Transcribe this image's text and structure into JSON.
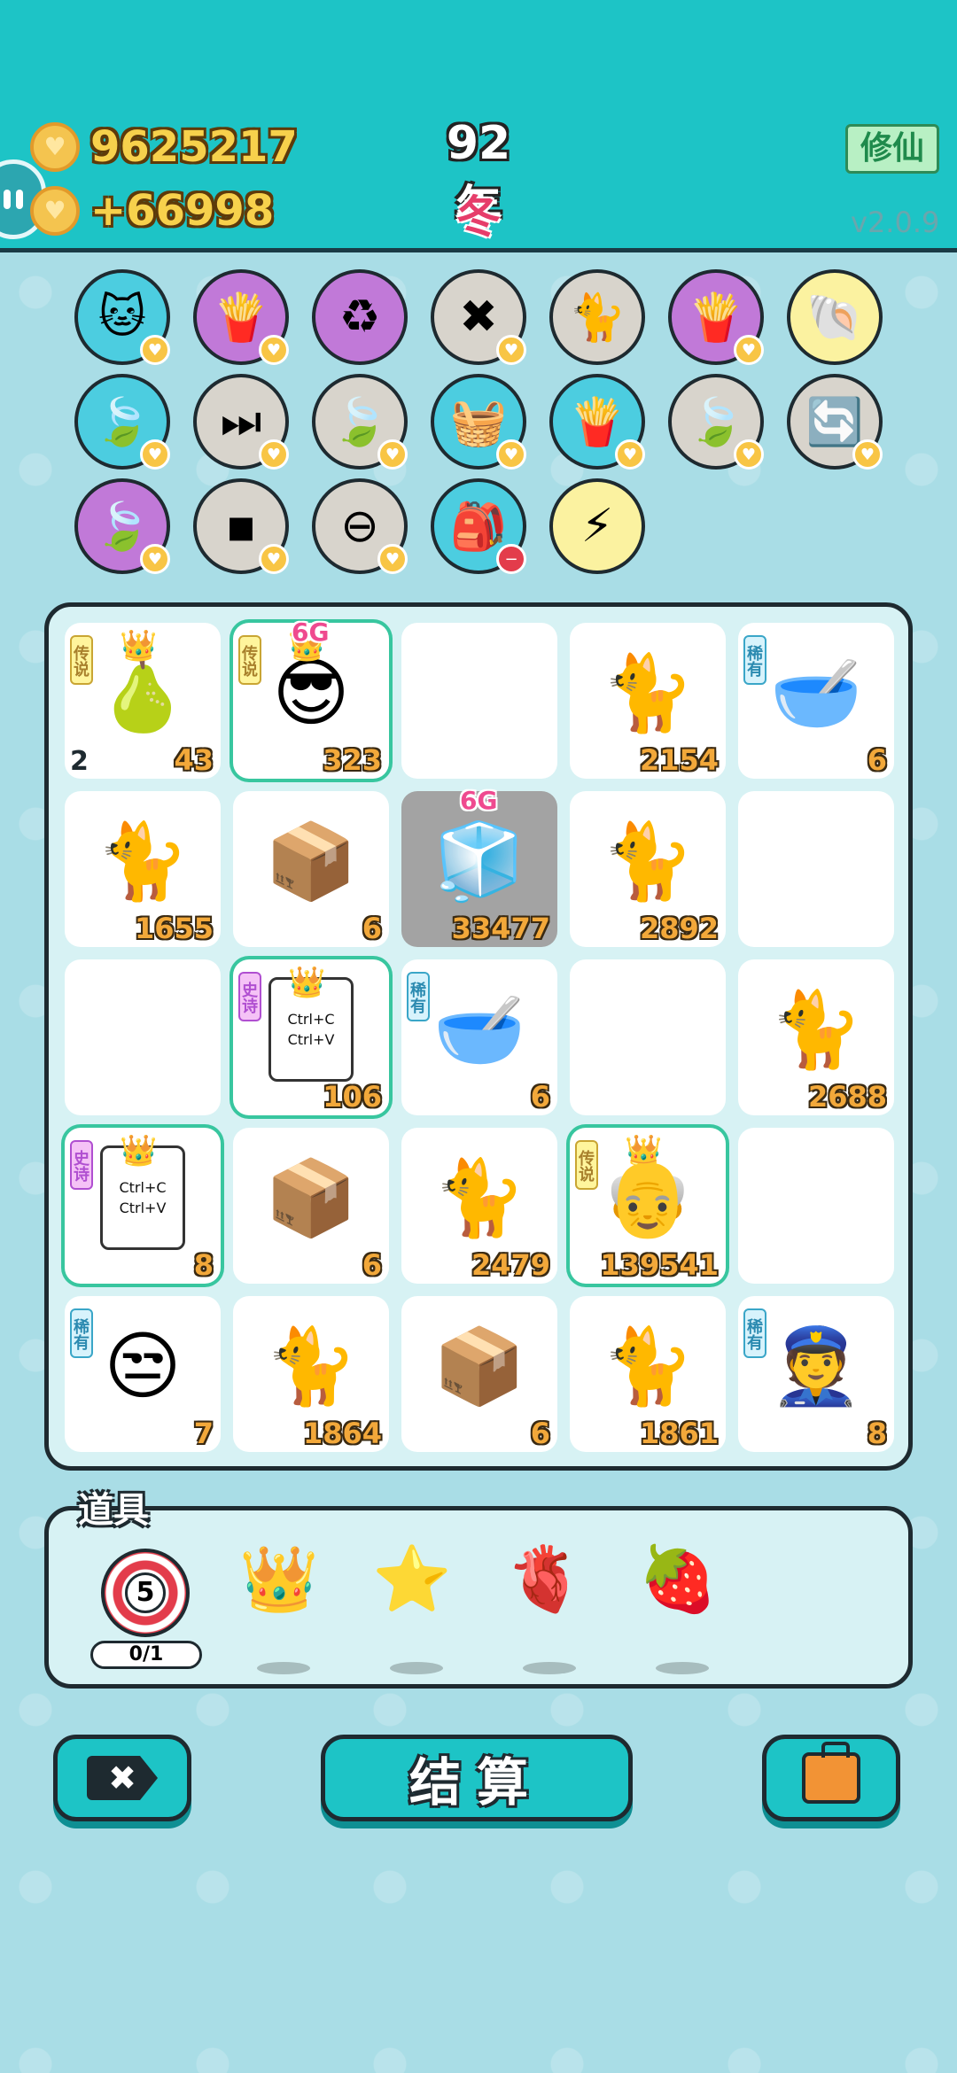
{
  "header": {
    "gold": "9625217",
    "income": "+66998",
    "year": "92年",
    "season": "冬",
    "mode_label": "修仙",
    "version": "v2.0.9"
  },
  "skills": [
    {
      "name": "cat-heads",
      "glyph": "🐱",
      "color": "cyan",
      "badge": "heart"
    },
    {
      "name": "fries",
      "glyph": "🍟",
      "color": "purple",
      "badge": "heart"
    },
    {
      "name": "recycle",
      "glyph": "♻",
      "color": "purple",
      "badge": ""
    },
    {
      "name": "delete-tag",
      "glyph": "✖",
      "color": "grey",
      "badge": "heart"
    },
    {
      "name": "twin-cats",
      "glyph": "🐈",
      "color": "grey",
      "badge": ""
    },
    {
      "name": "fries-2",
      "glyph": "🍟",
      "color": "purple",
      "badge": "heart"
    },
    {
      "name": "shell",
      "glyph": "🐚",
      "color": "yellow",
      "badge": ""
    },
    {
      "name": "leaf",
      "glyph": "🍃",
      "color": "cyan",
      "badge": "heart"
    },
    {
      "name": "skip",
      "glyph": "⏭",
      "color": "grey",
      "badge": "heart"
    },
    {
      "name": "leaf-2",
      "glyph": "🍃",
      "color": "grey",
      "badge": "heart"
    },
    {
      "name": "fruit-basket",
      "glyph": "🧺",
      "color": "cyan",
      "badge": "heart"
    },
    {
      "name": "fries-3",
      "glyph": "🍟",
      "color": "cyan",
      "badge": "heart"
    },
    {
      "name": "leaf-3",
      "glyph": "🍃",
      "color": "grey",
      "badge": "heart"
    },
    {
      "name": "refresh",
      "glyph": "🔄",
      "color": "grey",
      "badge": "heart"
    },
    {
      "name": "leaf-4",
      "glyph": "🍃",
      "color": "purple",
      "badge": "heart"
    },
    {
      "name": "cubes",
      "glyph": "▪",
      "color": "grey",
      "badge": "heart"
    },
    {
      "name": "minus",
      "glyph": "⊖",
      "color": "grey",
      "badge": "heart"
    },
    {
      "name": "sack",
      "glyph": "🎒",
      "color": "cyan",
      "badge": "remove"
    },
    {
      "name": "lightning",
      "glyph": "⚡",
      "color": "yellow",
      "badge": ""
    }
  ],
  "board": [
    {
      "icon": "pear",
      "glyph": "🍐",
      "value": "43",
      "left": "2",
      "tag": "传说",
      "tag_type": "legend",
      "crown": true
    },
    {
      "icon": "sunglasses-man",
      "glyph": "😎",
      "value": "323",
      "tag": "传说",
      "tag_type": "legend",
      "crown": true,
      "sixg": "6G",
      "epic": true
    },
    {
      "icon": "empty",
      "glyph": "",
      "value": ""
    },
    {
      "icon": "cat",
      "glyph": "🐈",
      "value": "2154"
    },
    {
      "icon": "gacha-bowl",
      "glyph": "🥣",
      "value": "6",
      "tag": "稀有",
      "tag_type": "rare"
    },
    {
      "icon": "cat",
      "glyph": "🐈",
      "value": "1655"
    },
    {
      "icon": "package",
      "glyph": "📦",
      "value": "6"
    },
    {
      "icon": "fridge",
      "glyph": "🧊",
      "value": "33477",
      "sixg": "6G",
      "dark": true
    },
    {
      "icon": "cat",
      "glyph": "🐈",
      "value": "2892"
    },
    {
      "icon": "empty",
      "glyph": "",
      "value": ""
    },
    {
      "icon": "empty",
      "glyph": "",
      "value": ""
    },
    {
      "icon": "copy-paste",
      "glyph": "",
      "value": "106",
      "tag": "史诗",
      "tag_type": "epic",
      "crown": true,
      "epic": true,
      "paste": true
    },
    {
      "icon": "gacha-bowl",
      "glyph": "🥣",
      "value": "6",
      "tag": "稀有",
      "tag_type": "rare"
    },
    {
      "icon": "empty",
      "glyph": "",
      "value": ""
    },
    {
      "icon": "cat",
      "glyph": "🐈",
      "value": "2688"
    },
    {
      "icon": "copy-paste",
      "glyph": "",
      "value": "8",
      "tag": "史诗",
      "tag_type": "epic",
      "crown": true,
      "epic": true,
      "paste": true
    },
    {
      "icon": "package",
      "glyph": "📦",
      "value": "6"
    },
    {
      "icon": "cat",
      "glyph": "🐈",
      "value": "2479"
    },
    {
      "icon": "grandpa",
      "glyph": "👴",
      "value": "139541",
      "tag": "传说",
      "tag_type": "legend",
      "crown": true,
      "epic": true
    },
    {
      "icon": "empty",
      "glyph": "",
      "value": ""
    },
    {
      "icon": "bucket-hat-man",
      "glyph": "😒",
      "value": "7",
      "tag": "稀有",
      "tag_type": "rare"
    },
    {
      "icon": "cat",
      "glyph": "🐈",
      "value": "1864"
    },
    {
      "icon": "package",
      "glyph": "📦",
      "value": "6"
    },
    {
      "icon": "cat",
      "glyph": "🐈",
      "value": "1861"
    },
    {
      "icon": "police-officer",
      "glyph": "👮",
      "value": "8",
      "tag": "稀有",
      "tag_type": "rare"
    }
  ],
  "paste_text": {
    "line1": "Ctrl+C",
    "line2": "Ctrl+V"
  },
  "props": {
    "title": "道具",
    "target_value": "5",
    "target_count": "0/1",
    "items": [
      {
        "name": "crown",
        "glyph": "👑"
      },
      {
        "name": "star",
        "glyph": "⭐"
      },
      {
        "name": "liver",
        "glyph": "🫀"
      },
      {
        "name": "lychee",
        "glyph": "🍓"
      }
    ]
  },
  "buttons": {
    "settle_label": "结算"
  }
}
